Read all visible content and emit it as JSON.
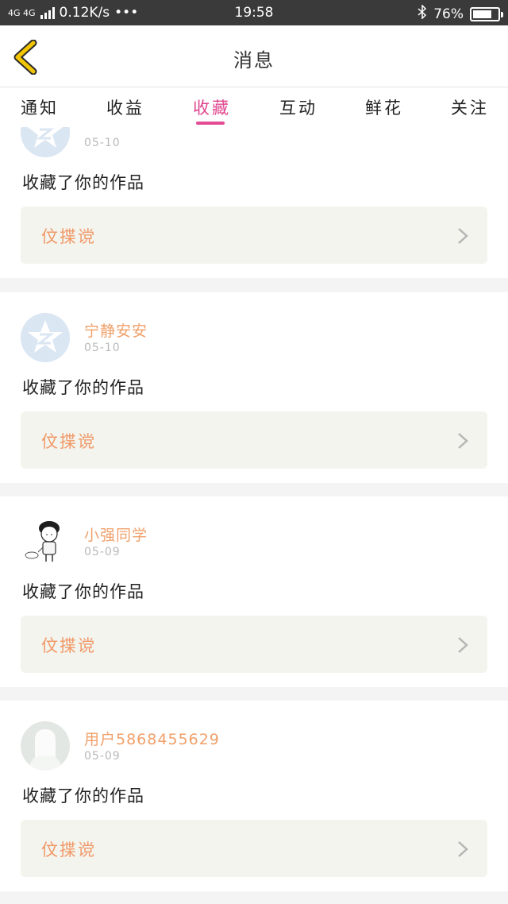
{
  "status_bar": {
    "network": "4G 4G",
    "speed": "0.12K/s",
    "dots": "•••",
    "time": "19:58",
    "battery": "76%",
    "battery_level": 0.76
  },
  "header": {
    "title": "消息"
  },
  "tabs": [
    {
      "label": "通知"
    },
    {
      "label": "收益"
    },
    {
      "label": "收藏",
      "active": true
    },
    {
      "label": "互动"
    },
    {
      "label": "鲜花"
    },
    {
      "label": "关注"
    }
  ],
  "items": [
    {
      "name": "",
      "date": "05-10",
      "action": "收藏了你的作品",
      "work_title": "伩揲谠",
      "avatar": "qzone-star"
    },
    {
      "name": "宁静安安",
      "date": "05-10",
      "action": "收藏了你的作品",
      "work_title": "伩揲谠",
      "avatar": "qzone-star"
    },
    {
      "name": "小强同学",
      "date": "05-09",
      "action": "收藏了你的作品",
      "work_title": "伩揲谠",
      "avatar": "cartoon-boy"
    },
    {
      "name": "用户5868455629",
      "date": "05-09",
      "action": "收藏了你的作品",
      "work_title": "伩揲谠",
      "avatar": "default-silhouette"
    }
  ],
  "colors": {
    "accent": "#e44b95",
    "name": "#f0a06a",
    "back": "#f2c500"
  }
}
